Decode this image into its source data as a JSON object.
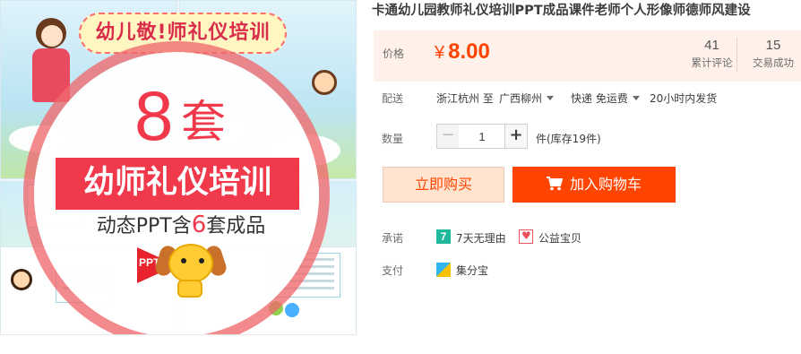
{
  "product_image": {
    "banner_text": "幼儿敬!师礼仪培训",
    "count_number": "8",
    "count_unit": "套",
    "headline": "幼师礼仪培训",
    "subline_before": "动态PPT含",
    "subline_highlight": "6",
    "subline_after": "套成品",
    "ppt_badge": "PPT"
  },
  "product": {
    "title": "卡通幼儿园教师礼仪培训PPT成品课件老师个人形像师德师风建设"
  },
  "price": {
    "label": "价格",
    "currency": "¥",
    "value": "8.00"
  },
  "stats": {
    "reviews_count": "41",
    "reviews_label": "累计评论",
    "deals_count": "15",
    "deals_label": "交易成功"
  },
  "shipping": {
    "label": "配送",
    "from": "浙江杭州 至",
    "to": "广西柳州",
    "method": "快递 免运费",
    "dispatch": "20小时内发货"
  },
  "quantity": {
    "label": "数量",
    "minus": "−",
    "value": "1",
    "plus": "+",
    "unit_stock": "件(库存19件)"
  },
  "actions": {
    "buy_now": "立即购买",
    "add_to_cart": "加入购物车"
  },
  "promise": {
    "label": "承诺",
    "items": [
      {
        "icon": "seven-days-icon",
        "text": "7天无理由"
      },
      {
        "icon": "charity-heart-icon",
        "text": "公益宝贝"
      }
    ]
  },
  "payment": {
    "label": "支付",
    "method": "集分宝",
    "icon": "jifenbao-icon"
  },
  "colors": {
    "accent": "#ff4400",
    "price_bg": "#fff1ea",
    "image_red": "#f0394a"
  }
}
